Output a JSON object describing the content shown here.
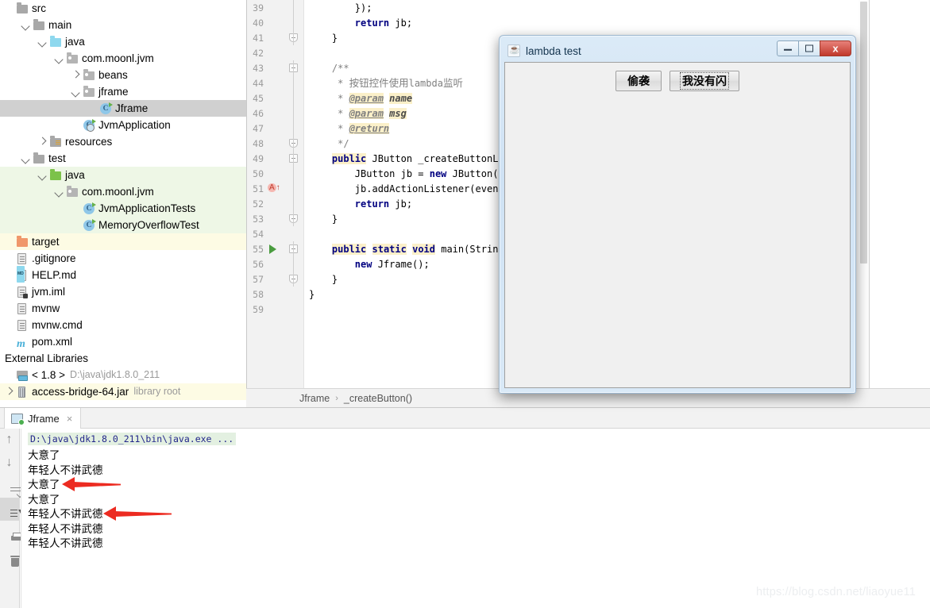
{
  "project_tree": {
    "items": [
      {
        "label": "src",
        "indent": 0,
        "twisty": "none",
        "icon": "folder-gray",
        "bg": "none"
      },
      {
        "label": "main",
        "indent": 1,
        "twisty": "down",
        "icon": "folder-gray",
        "bg": "none"
      },
      {
        "label": "java",
        "indent": 2,
        "twisty": "down",
        "icon": "folder-blue",
        "bg": "none"
      },
      {
        "label": "com.moonl.jvm",
        "indent": 3,
        "twisty": "down",
        "icon": "package",
        "bg": "none"
      },
      {
        "label": "beans",
        "indent": 4,
        "twisty": "right",
        "icon": "package",
        "bg": "none"
      },
      {
        "label": "jframe",
        "indent": 4,
        "twisty": "down",
        "icon": "package",
        "bg": "none"
      },
      {
        "label": "Jframe",
        "indent": 5,
        "twisty": "none",
        "icon": "class",
        "bg": "selected"
      },
      {
        "label": "JvmApplication",
        "indent": 4,
        "twisty": "none",
        "icon": "class-spring",
        "bg": "none"
      },
      {
        "label": "resources",
        "indent": 2,
        "twisty": "right",
        "icon": "folder-resources",
        "bg": "none"
      },
      {
        "label": "test",
        "indent": 1,
        "twisty": "down",
        "icon": "folder-gray",
        "bg": "none"
      },
      {
        "label": "java",
        "indent": 2,
        "twisty": "down",
        "icon": "folder-green",
        "bg": "green"
      },
      {
        "label": "com.moonl.jvm",
        "indent": 3,
        "twisty": "down",
        "icon": "package",
        "bg": "green"
      },
      {
        "label": "JvmApplicationTests",
        "indent": 4,
        "twisty": "none",
        "icon": "class",
        "bg": "green"
      },
      {
        "label": "MemoryOverflowTest",
        "indent": 4,
        "twisty": "none",
        "icon": "class",
        "bg": "green"
      },
      {
        "label": "target",
        "indent": 0,
        "twisty": "none",
        "icon": "folder-orange",
        "bg": "yellow"
      },
      {
        "label": ".gitignore",
        "indent": 0,
        "twisty": "none",
        "icon": "file",
        "bg": "none"
      },
      {
        "label": "HELP.md",
        "indent": 0,
        "twisty": "none",
        "icon": "file-md",
        "bg": "none"
      },
      {
        "label": "jvm.iml",
        "indent": 0,
        "twisty": "none",
        "icon": "file-iml",
        "bg": "none"
      },
      {
        "label": "mvnw",
        "indent": 0,
        "twisty": "none",
        "icon": "file",
        "bg": "none"
      },
      {
        "label": "mvnw.cmd",
        "indent": 0,
        "twisty": "none",
        "icon": "file",
        "bg": "none"
      },
      {
        "label": "pom.xml",
        "indent": 0,
        "twisty": "none",
        "icon": "maven",
        "bg": "none"
      },
      {
        "label": "External Libraries",
        "indent": -1,
        "twisty": "none",
        "icon": "none",
        "bg": "none"
      },
      {
        "label": "< 1.8 >",
        "sublabel": "D:\\java\\jdk1.8.0_211",
        "indent": 0,
        "twisty": "none",
        "icon": "sdk",
        "bg": "none"
      },
      {
        "label": "access-bridge-64.jar",
        "sublabel": "library root",
        "indent": 0,
        "twisty": "right",
        "icon": "jar",
        "bg": "yellow"
      }
    ]
  },
  "editor": {
    "lines": [
      {
        "no": "39",
        "text": "        });",
        "fold": "bar"
      },
      {
        "no": "40",
        "text": "        return jb;",
        "fold": "bar"
      },
      {
        "no": "41",
        "text": "    }",
        "fold": "end"
      },
      {
        "no": "42",
        "text": "",
        "fold": "none"
      },
      {
        "no": "43",
        "text": "    /**",
        "fold": "start"
      },
      {
        "no": "44",
        "text": "     * 按钮控件使用lambda监听",
        "fold": "bar"
      },
      {
        "no": "45",
        "text": "     * @param name",
        "fold": "bar"
      },
      {
        "no": "46",
        "text": "     * @param msg",
        "fold": "bar"
      },
      {
        "no": "47",
        "text": "     * @return",
        "fold": "bar"
      },
      {
        "no": "48",
        "text": "     */",
        "fold": "end"
      },
      {
        "no": "49",
        "text": "    public JButton _createButtonLambda(Str",
        "fold": "start"
      },
      {
        "no": "50",
        "text": "        JButton jb = new JButton(name);",
        "fold": "bar"
      },
      {
        "no": "51",
        "text": "        jb.addActionListener(event -> Syst",
        "fold": "bar"
      },
      {
        "no": "52",
        "text": "        return jb;",
        "fold": "bar"
      },
      {
        "no": "53",
        "text": "    }",
        "fold": "end"
      },
      {
        "no": "54",
        "text": "",
        "fold": "none"
      },
      {
        "no": "55",
        "text": "    public static void main(String[] args)",
        "fold": "start"
      },
      {
        "no": "56",
        "text": "        new Jframe();",
        "fold": "bar"
      },
      {
        "no": "57",
        "text": "    }",
        "fold": "end"
      },
      {
        "no": "58",
        "text": "}",
        "fold": "none"
      },
      {
        "no": "59",
        "text": "",
        "fold": "none"
      }
    ],
    "run_marker_line": "55",
    "warning_marker_line": "51"
  },
  "breadcrumb": {
    "class": "Jframe",
    "separator": "›",
    "method": "_createButton()"
  },
  "dialog": {
    "title": "lambda test",
    "icon": "java-coffee-icon",
    "minimize_label": "minimize",
    "maximize_label": "maximize",
    "close_label": "x",
    "buttons": [
      {
        "label": "偷袭",
        "focused": false
      },
      {
        "label": "我没有闪",
        "focused": true
      }
    ]
  },
  "console": {
    "tab_label": "Jframe",
    "tab_close": "×",
    "toolbar_icons": [
      "arrow-up-icon",
      "arrow-down-icon",
      "soft-wrap-icon",
      "scroll-to-end-icon",
      "print-icon",
      "trash-icon"
    ],
    "command_line": "D:\\java\\jdk1.8.0_211\\bin\\java.exe ...",
    "output_lines": [
      "大意了",
      "年轻人不讲武德",
      "大意了",
      "大意了",
      "年轻人不讲武德",
      "年轻人不讲武德",
      "年轻人不讲武德"
    ],
    "annotations": [
      {
        "type": "red-arrow",
        "points_to_line_index": 2
      },
      {
        "type": "red-arrow",
        "points_to_line_index": 4
      }
    ]
  },
  "watermark": {
    "text": "https://blog.csdn.net/liaoyue11"
  },
  "colors": {
    "selection": "#d0d0d0",
    "test_source_tint": "#eef7e6",
    "library_tint": "#fdfbe4",
    "keyword": "#000080",
    "comment": "#808080",
    "arrow_red": "#ec2b21",
    "run_green": "#4a9c3f",
    "console_cmd": "#22268a"
  }
}
